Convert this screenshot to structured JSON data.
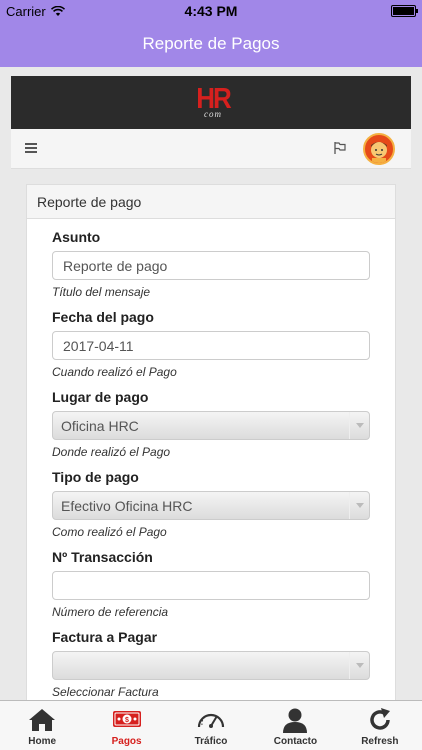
{
  "status_bar": {
    "carrier": "Carrier",
    "time": "4:43 PM"
  },
  "nav": {
    "title": "Reporte de Pagos"
  },
  "site": {
    "logo_main": "HR",
    "logo_sub": "com"
  },
  "panel": {
    "heading": "Reporte de pago"
  },
  "form": {
    "asunto": {
      "label": "Asunto",
      "value": "Reporte de pago",
      "help": "Título del mensaje"
    },
    "fecha": {
      "label": "Fecha del pago",
      "value": "2017-04-11",
      "help": "Cuando realizó el Pago"
    },
    "lugar": {
      "label": "Lugar de pago",
      "value": "Oficina HRC",
      "help": "Donde realizó el Pago"
    },
    "tipo": {
      "label": "Tipo de pago",
      "value": "Efectivo Oficina HRC",
      "help": "Como realizó el Pago"
    },
    "transaccion": {
      "label": "Nº Transacción",
      "value": "",
      "help": "Número de referencia"
    },
    "factura": {
      "label": "Factura a Pagar",
      "value": "",
      "help": "Seleccionar Factura"
    }
  },
  "tabs": [
    {
      "label": "Home",
      "icon": "home-icon",
      "active": false
    },
    {
      "label": "Pagos",
      "icon": "payment-icon",
      "active": true
    },
    {
      "label": "Tráfico",
      "icon": "speedometer-icon",
      "active": false
    },
    {
      "label": "Contacto",
      "icon": "person-icon",
      "active": false
    },
    {
      "label": "Refresh",
      "icon": "refresh-icon",
      "active": false
    }
  ],
  "colors": {
    "header_purple": "#a187e8",
    "brand_red": "#d6201e",
    "site_dark": "#2b2b2b"
  }
}
